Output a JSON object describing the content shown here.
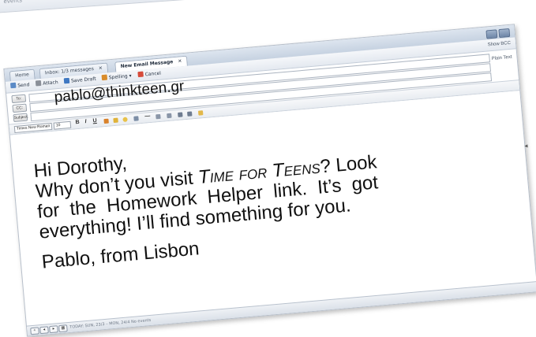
{
  "background_window": {
    "label": "events"
  },
  "tabs": [
    {
      "label": "Home"
    },
    {
      "label": "Inbox: 1/3 messages"
    },
    {
      "label": "New Email Message"
    }
  ],
  "toolbar": {
    "send": "Send",
    "attach": "Attach",
    "save_draft": "Save Draft",
    "spelling": "Spelling ▾",
    "cancel": "Cancel",
    "show_bcc": "Show BCC",
    "plain_text": "Plain Text"
  },
  "fields": {
    "to_label": "To:",
    "cc_label": "CC:",
    "subject_label": "Subject:",
    "to_value": "pablo@thinkteen.gr"
  },
  "format": {
    "font": "Times New Roman",
    "size": "10"
  },
  "message": {
    "line1": "Hi Dorothy,",
    "line2_pre": "Why don’t you visit ",
    "line2_title": "Time for Teens",
    "line2_post": "? Look",
    "line3": "for  the  Homework  Helper  link.  It’s  got",
    "line4": "everything! I’ll find something for you.",
    "signature": "Pablo, from Lisbon"
  },
  "status": {
    "text": "TODAY: SUN, 23/3 – MON, 24/4  No events"
  },
  "colors": {
    "chrome": "#c6d2e1",
    "text": "#111111"
  }
}
